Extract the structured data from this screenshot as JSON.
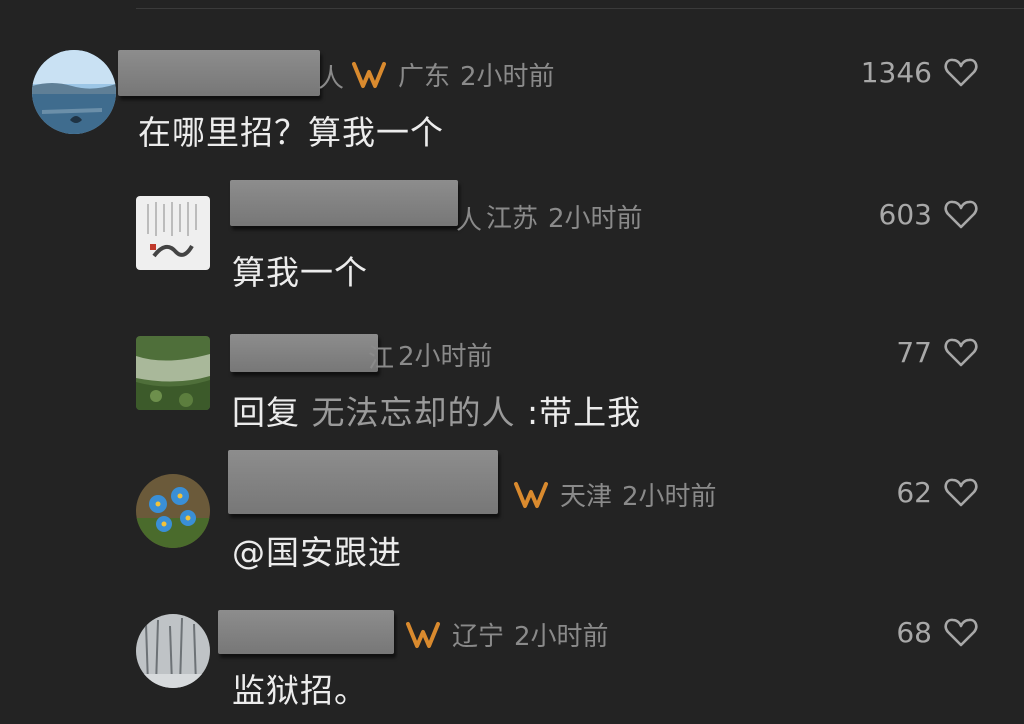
{
  "colors": {
    "background": "#232323",
    "vip_badge": "#d98a2e",
    "meta_text": "#8a8a8a",
    "body_text": "#ececec"
  },
  "icons": {
    "vip_badge": "vip-badge-icon",
    "like": "heart-icon"
  },
  "comments": [
    {
      "name_tail": "人",
      "vip": true,
      "location": "广东",
      "time": "2小时前",
      "likes": "1346",
      "text": "在哪里招？算我一个"
    },
    {
      "name_tail": "人",
      "vip": false,
      "location": "江苏",
      "time": "2小时前",
      "likes": "603",
      "text": "算我一个"
    },
    {
      "name_tail": "江",
      "vip": false,
      "location": "",
      "time": "2小时前",
      "likes": "77",
      "reply_prefix": "回复",
      "reply_to": "无法忘却的人",
      "text": ":带上我"
    },
    {
      "name_tail": "",
      "vip": true,
      "location": "天津",
      "time": "2小时前",
      "likes": "62",
      "text": "@国安跟进"
    },
    {
      "name_tail": "",
      "vip": true,
      "location": "辽宁",
      "time": "2小时前",
      "likes": "68",
      "text": "监狱招。"
    }
  ]
}
